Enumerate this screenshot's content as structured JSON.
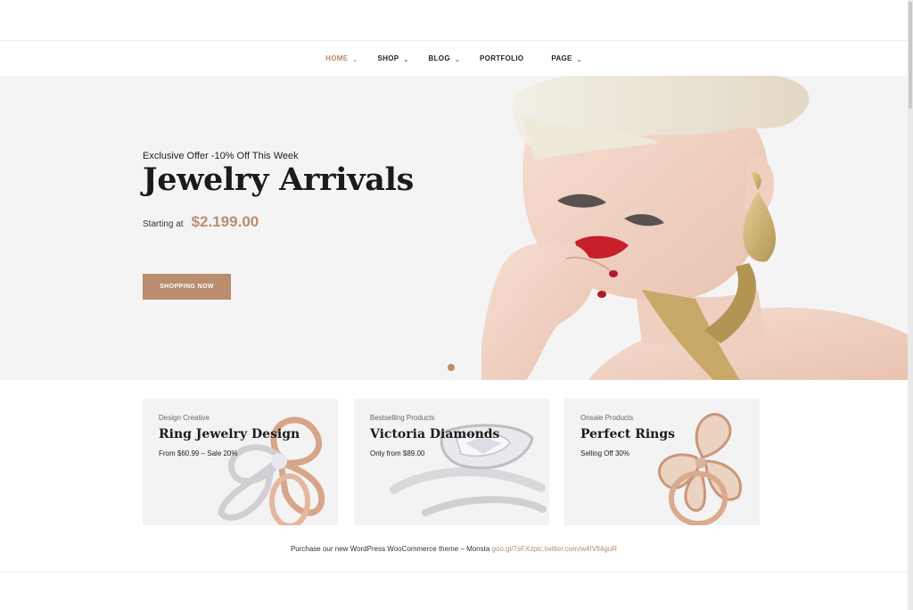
{
  "nav": {
    "items": [
      {
        "label": "HOME",
        "chevron": "chevron-down-icon"
      },
      {
        "label": "SHOP",
        "chevron": "chevron-down-icon"
      },
      {
        "label": "BLOG",
        "chevron": "chevron-down-icon"
      },
      {
        "label": "PORTFOLIO"
      },
      {
        "label": "PAGE",
        "chevron": "chevron-down-icon"
      }
    ],
    "active_color": "#b98d6e"
  },
  "hero": {
    "offer": "Exclusive Offer -10% Off This Week",
    "title": "Jewelry Arrivals",
    "starting_label": "Starting at",
    "price": "$2.199.00",
    "button_label": "SHOPPING NOW",
    "slide_index": 1,
    "accent": "#b98d6e"
  },
  "banners": [
    {
      "subtitle": "Design Creative",
      "title": "Ring Jewelry Design",
      "desc": "From $60.99 – Sale 20%"
    },
    {
      "subtitle": "Bestselling Products",
      "title": "Victoria Diamonds",
      "desc": "Only from $89.00"
    },
    {
      "subtitle": "Onsale Products",
      "title": "Perfect Rings",
      "desc": "Selling Off 30%"
    }
  ],
  "footer_note": {
    "text": "Purchase our new WordPress WooCommerce theme – Monsta ",
    "link": "goo.gl/7sFXzpic.twitter.com/w4IVfi4guR"
  }
}
